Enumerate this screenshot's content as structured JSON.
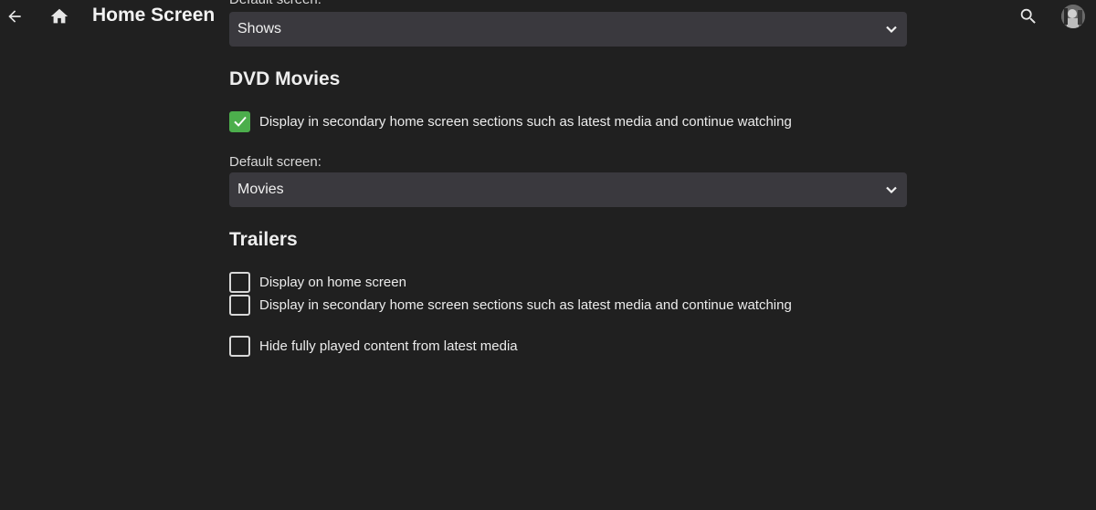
{
  "header": {
    "title": "Home Screen",
    "back_icon": "arrow-left-icon",
    "home_icon": "home-icon",
    "search_icon": "search-icon"
  },
  "shows_section": {
    "default_label": "Default screen:",
    "default_value": "Shows"
  },
  "dvd_movies": {
    "title": "DVD Movies",
    "secondary_label": "Display in secondary home screen sections such as latest media and continue watching",
    "secondary_checked": true,
    "default_label": "Default screen:",
    "default_value": "Movies"
  },
  "trailers": {
    "title": "Trailers",
    "home_label": "Display on home screen",
    "home_checked": false,
    "secondary_label": "Display in secondary home screen sections such as latest media and continue watching",
    "secondary_checked": false
  },
  "hide_played": {
    "label": "Hide fully played content from latest media",
    "checked": false
  },
  "colors": {
    "background": "#202020",
    "select_bg": "#3a393e",
    "accent_green": "#4cae4c"
  }
}
